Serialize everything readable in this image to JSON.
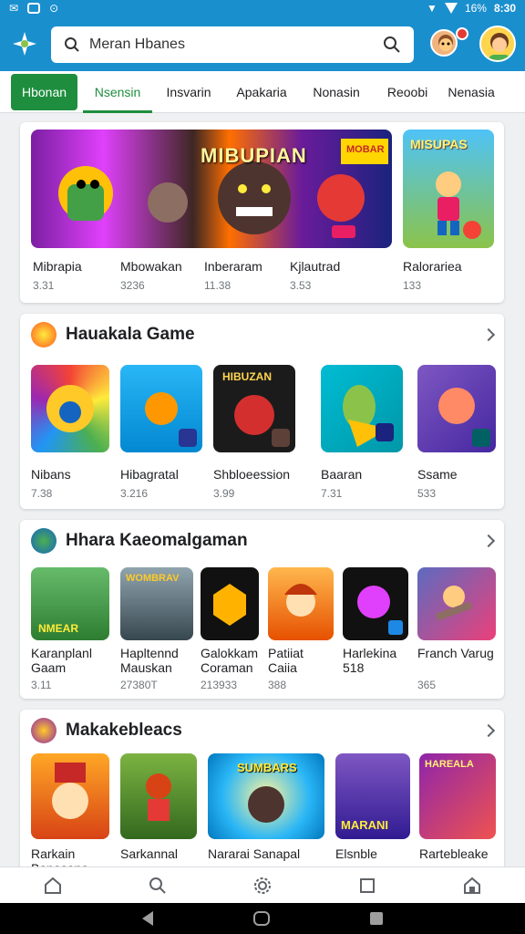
{
  "status_bar": {
    "left_icons": [
      "notification-icon",
      "notification-icon",
      "notification-icon"
    ],
    "signal": "16%",
    "time": "8:30"
  },
  "app_bar": {
    "search_placeholder": "Meran Hbanes"
  },
  "tabs": [
    "Hbonan",
    "Nsensin",
    "Insvarin",
    "Apakaria",
    "Nonasin",
    "Reoobi",
    "Nenasia"
  ],
  "featured": {
    "banner_text": "MIBUPIAN",
    "banner_badge": "MOBAR",
    "right_tile_text": "MISUPAS",
    "items": [
      {
        "name": "Mibrapia",
        "meta": "3.31"
      },
      {
        "name": "Mbowakan",
        "meta": "3236"
      },
      {
        "name": "Inberaram",
        "meta": "11.38"
      },
      {
        "name": "Kjlautrad",
        "meta": "3.53"
      },
      {
        "name": "Ralorariea",
        "meta": "133"
      }
    ]
  },
  "section1": {
    "title": "Hauakala Game",
    "items": [
      {
        "name": "Nibans",
        "meta": "7.38"
      },
      {
        "name": "Hibagratal",
        "meta": "3.216"
      },
      {
        "name": "Shbloeession",
        "meta": "3.99",
        "tile_text": "HIBUZAN"
      },
      {
        "name": "Baaran",
        "meta": "7.31"
      },
      {
        "name": "Ssame",
        "meta": "533"
      }
    ]
  },
  "section2": {
    "title": "Hhara Kaeomalgaman",
    "items": [
      {
        "name": "Karanplanl Gaam",
        "meta": "3.11",
        "tile_text": "NMEAR"
      },
      {
        "name": "Hapltennd Mauskan",
        "meta": "27380T",
        "tile_text": "WOMBRAV"
      },
      {
        "name": "Galokkam Coraman",
        "meta": "213933"
      },
      {
        "name": "Patiiat Caiia",
        "meta": "388"
      },
      {
        "name": "Harlekina 518",
        "meta": ""
      },
      {
        "name": "Franch Varug",
        "meta": "365"
      }
    ]
  },
  "section3": {
    "title": "Makakebleacs",
    "items": [
      {
        "name": "Rarkain Banasana",
        "meta": ""
      },
      {
        "name": "Sarkannal",
        "meta": ""
      },
      {
        "name": "Nararai Sanapal",
        "meta": "",
        "tile_text": "SUMBARS"
      },
      {
        "name": "Elsnble",
        "meta": "",
        "tile_text": "MARANI"
      },
      {
        "name": "Rartebleake",
        "meta": "",
        "tile_text": "HAREALA"
      }
    ]
  },
  "bottom_nav": [
    "home-icon",
    "search-icon",
    "settings-icon",
    "library-icon",
    "store-icon"
  ]
}
